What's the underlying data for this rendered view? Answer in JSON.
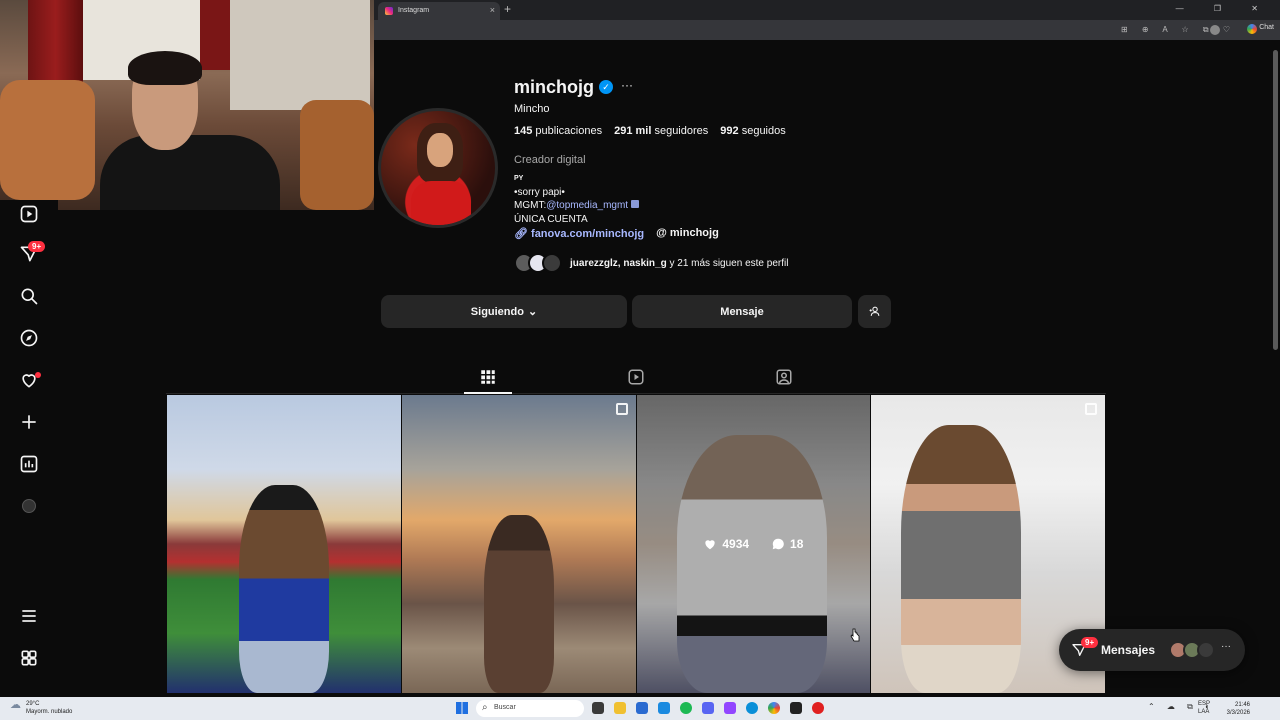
{
  "browser": {
    "tab_title": "Instagram",
    "tab_close": "×",
    "new_tab": "+",
    "window_controls": "— ❐ ✕",
    "toolbar_icons": "⊞ ⊕ A ☆ ⧉ ♡",
    "chat_label": "Chat"
  },
  "profile": {
    "username": "minchojg",
    "verified_mark": "✓",
    "more": "···",
    "full_name": "Mincho",
    "stats": {
      "posts_count": "145",
      "posts_label": "publicaciones",
      "followers_count": "291 mil",
      "followers_label": "seguidores",
      "following_count": "992",
      "following_label": "seguidos"
    },
    "category": "Creador digital",
    "bio": {
      "line1": "PY",
      "line2": "•sorry papi•",
      "line3_prefix": "MGMT:",
      "line3_mention": "@topmedia_mgmt",
      "line4": "ÚNICA CUENTA"
    },
    "link_url": "fanova.com/minchojg",
    "threads_handle": "minchojg",
    "followed_by": {
      "names": "juarezzglz, naskin_g",
      "rest": " y 21 más siguen este perfil"
    },
    "buttons": {
      "following": "Siguiendo",
      "message": "Mensaje"
    }
  },
  "tabs": [
    "posts-grid",
    "reels",
    "tagged"
  ],
  "posts": [
    {
      "id": "post-1",
      "kind": "image"
    },
    {
      "id": "post-2",
      "kind": "carousel"
    },
    {
      "id": "post-3",
      "kind": "reel",
      "likes": "4934",
      "comments": "18"
    },
    {
      "id": "post-4",
      "kind": "carousel"
    }
  ],
  "nav": {
    "notifications_badge": "9+"
  },
  "messages": {
    "label": "Mensajes",
    "badge": "9+",
    "more": "···"
  },
  "taskbar": {
    "weather_temp": "29°C",
    "weather_desc": "Mayorm. nublado",
    "search_placeholder": "Buscar",
    "lang_line1": "ESP",
    "lang_line2": "LAA",
    "time": "21:46",
    "date": "3/3/2026"
  },
  "colors": {
    "background": "#0b0b0b",
    "surface": "#262626",
    "verified": "#0095f6",
    "link": "#a8b8ff",
    "badge": "#ff3040"
  }
}
